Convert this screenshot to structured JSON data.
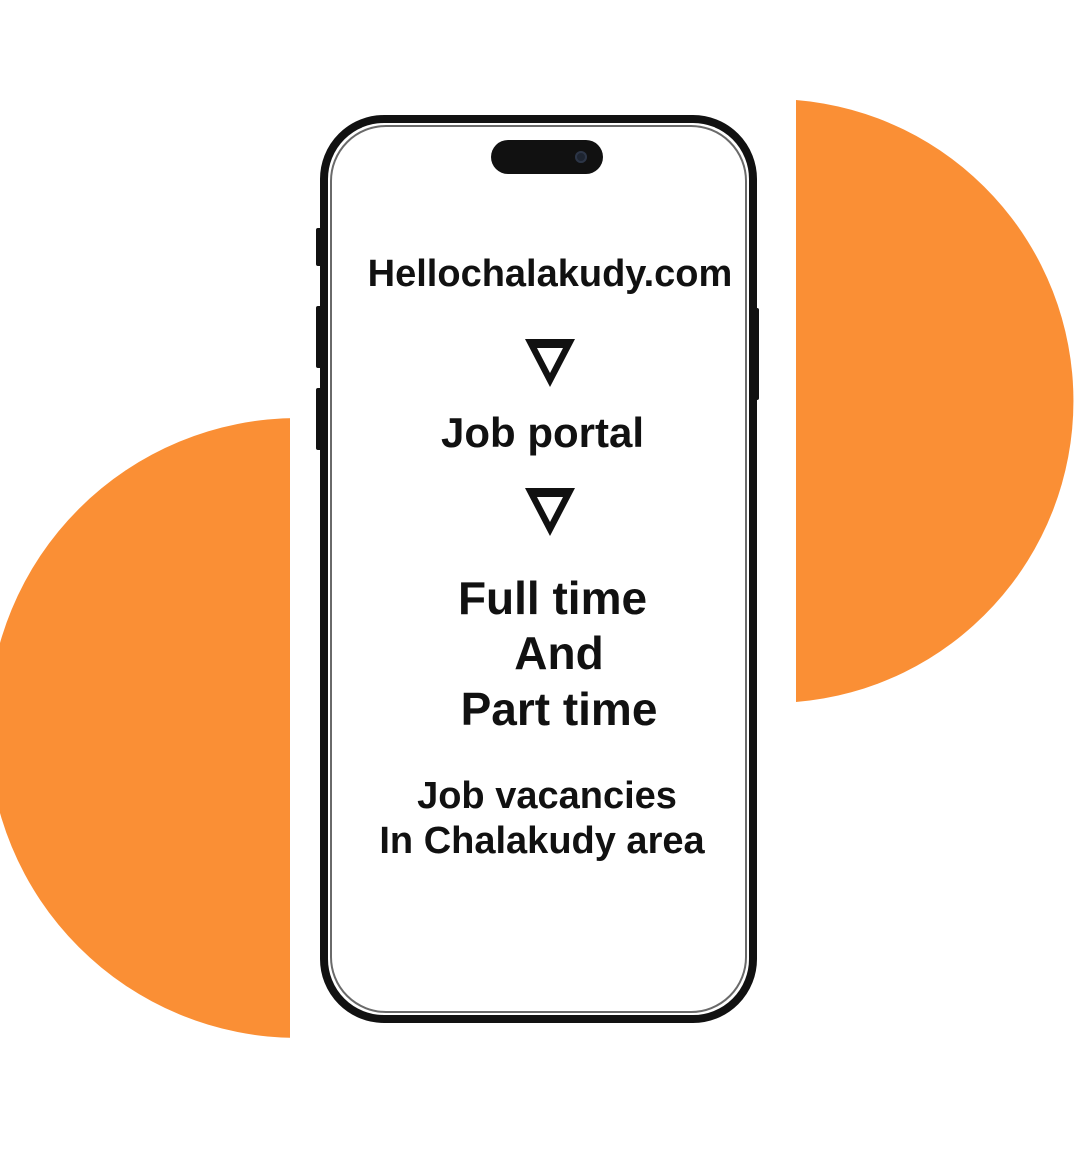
{
  "colors": {
    "accent": "#fa8f35",
    "text": "#111111",
    "phone_frame": "#111111",
    "background": "#ffffff"
  },
  "screen": {
    "site": "Hellochalakudy.com",
    "arrow_icon_1": "down-triangle-icon",
    "portal": "Job portal",
    "arrow_icon_2": "down-triangle-icon",
    "line_full": "Full time",
    "line_and": "And",
    "line_part": "Part time",
    "vacancies_line1": "Job vacancies",
    "vacancies_line2": "In Chalakudy area"
  }
}
